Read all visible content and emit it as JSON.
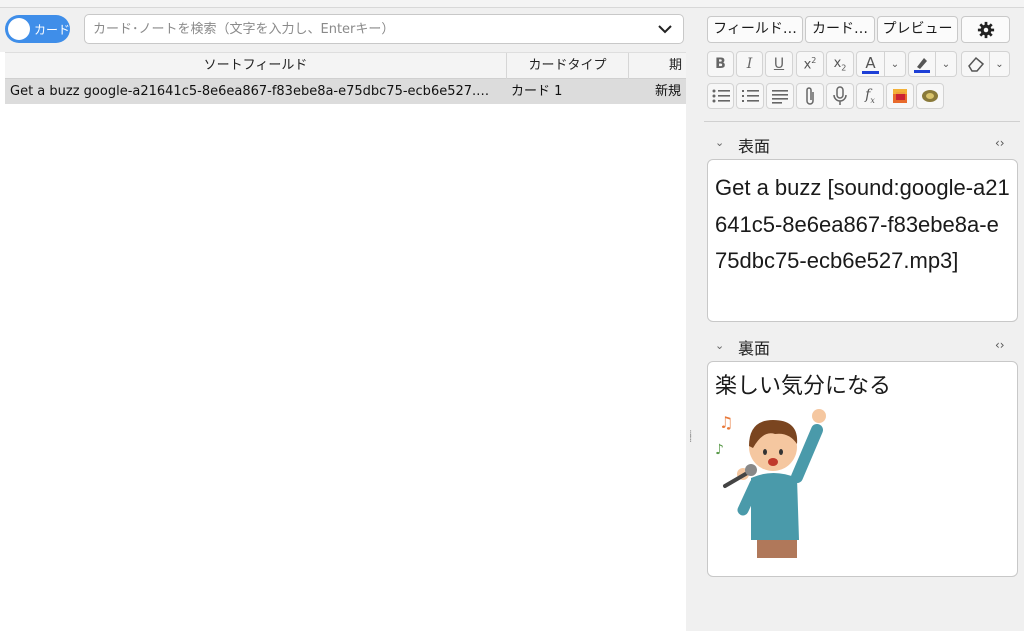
{
  "browse": {
    "toggle_label": "カード",
    "search_placeholder": "カード･ノートを検索（文字を入力し、Enterキー）",
    "columns": [
      "ソートフィールド",
      "カードタイプ",
      "期"
    ],
    "rows": [
      {
        "sort_field": "Get a buzz google-a21641c5-8e6ea867-f83ebe8a-e75dbc75-ecb6e527.…",
        "card_type": "カード 1",
        "due": "新規"
      }
    ]
  },
  "editor": {
    "top_buttons": [
      "フィールド…",
      "カード…",
      "プレビュー"
    ],
    "format_icons": [
      "bold-icon",
      "italic-icon",
      "underline-icon",
      "superscript-icon",
      "subscript-icon",
      "text-color-icon",
      "text-color-dropdown-icon",
      "highlight-icon",
      "highlight-dropdown-icon",
      "eraser-icon",
      "eraser-dropdown-icon",
      "unordered-list-icon",
      "ordered-list-icon",
      "align-icon",
      "attach-icon",
      "microphone-icon",
      "math-icon",
      "image-occlusion-icon",
      "tts-icon"
    ],
    "fields": [
      {
        "label": "表面",
        "value": "Get a buzz [sound:google-a21641c5-8e6ea867-f83ebe8a-e75dbc75-ecb6e527.mp3]"
      },
      {
        "label": "裏面",
        "value": "楽しい気分になる"
      }
    ],
    "colors": {
      "accent": "#3f8ee9",
      "text_color_underline": "#1d3fd6",
      "highlight_underline": "#1d3fd6"
    }
  }
}
